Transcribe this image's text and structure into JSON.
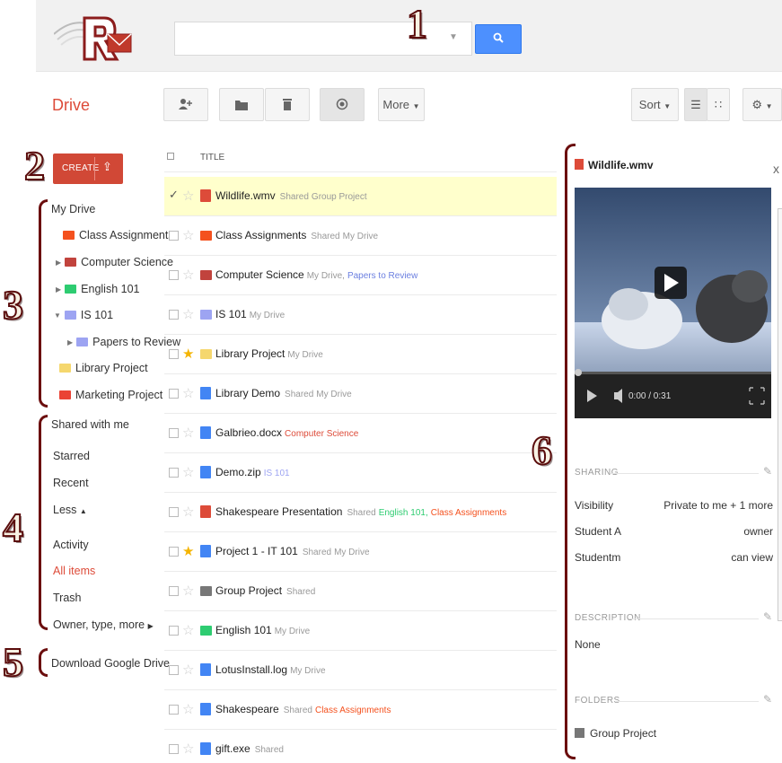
{
  "callouts": [
    "1",
    "2",
    "3",
    "4",
    "5",
    "6"
  ],
  "search": {
    "placeholder": "",
    "button_icon": "search-icon"
  },
  "toolbar": {
    "drive_label": "Drive",
    "more_label": "More",
    "sort_label": "Sort"
  },
  "nav": {
    "create_label": "CREATE",
    "my_drive": "My Drive",
    "folders": [
      {
        "label": "Class Assignments",
        "color": "#f4511e"
      },
      {
        "label": "Computer Science",
        "color": "#c1433d"
      },
      {
        "label": "English 101",
        "color": "#2ecc71"
      },
      {
        "label": "IS 101",
        "color": "#9da4f2"
      },
      {
        "label": "Papers to Review",
        "color": "#9da4f2"
      },
      {
        "label": "Library Project",
        "color": "#f5d76e"
      },
      {
        "label": "Marketing Project",
        "color": "#ea4335"
      }
    ],
    "shared_with_me": "Shared with me",
    "starred": "Starred",
    "recent": "Recent",
    "less": "Less",
    "activity": "Activity",
    "all_items": "All items",
    "trash": "Trash",
    "owner_type_more": "Owner, type, more",
    "download": "Download Google Drive"
  },
  "list": {
    "title_header": "TITLE",
    "rows": [
      {
        "name": "Wildlife.wmv",
        "tag": "Shared",
        "loc": "Group Project",
        "loc_color": "#999",
        "icon_color": "#dd4b39",
        "selected": true,
        "starred": false
      },
      {
        "name": "Class Assignments",
        "tag": "Shared",
        "loc": "My Drive",
        "loc_color": "#999",
        "icon_color": "#f4511e",
        "selected": false,
        "starred": false
      },
      {
        "name": "Computer Science",
        "tag": "",
        "loc": "My Drive,",
        "loc2": "Papers to Review",
        "loc_color": "#999",
        "loc2_color": "#6b7fe0",
        "icon_color": "#c1433d",
        "selected": false,
        "starred": false
      },
      {
        "name": "IS 101",
        "tag": "",
        "loc": "My Drive",
        "loc_color": "#999",
        "icon_color": "#9da4f2",
        "selected": false,
        "starred": false
      },
      {
        "name": "Library Project",
        "tag": "",
        "loc": "My Drive",
        "loc_color": "#999",
        "icon_color": "#f5d76e",
        "selected": false,
        "starred": true
      },
      {
        "name": "Library Demo",
        "tag": "Shared",
        "loc": "My Drive",
        "loc_color": "#999",
        "icon_color": "#4285f4",
        "selected": false,
        "starred": false
      },
      {
        "name": "Galbrieo.docx",
        "tag": "",
        "loc": "Computer Science",
        "loc_color": "#dd4b39",
        "icon_color": "#4285f4",
        "selected": false,
        "starred": false
      },
      {
        "name": "Demo.zip",
        "tag": "",
        "loc": "IS 101",
        "loc_color": "#9da4f2",
        "icon_color": "#4285f4",
        "selected": false,
        "starred": false
      },
      {
        "name": "Shakespeare Presentation",
        "tag": "Shared",
        "loc": "English 101,",
        "loc2": "Class Assignments",
        "loc_color": "#2ecc71",
        "loc2_color": "#f4511e",
        "icon_color": "#dd4b39",
        "selected": false,
        "starred": false
      },
      {
        "name": "Project 1 - IT 101",
        "tag": "Shared",
        "loc": "My Drive",
        "loc_color": "#999",
        "icon_color": "#4285f4",
        "selected": false,
        "starred": true
      },
      {
        "name": "Group Project",
        "tag": "Shared",
        "loc": "",
        "loc_color": "#999",
        "icon_color": "#777",
        "selected": false,
        "starred": false
      },
      {
        "name": "English 101",
        "tag": "",
        "loc": "My Drive",
        "loc_color": "#999",
        "icon_color": "#2ecc71",
        "selected": false,
        "starred": false
      },
      {
        "name": "LotusInstall.log",
        "tag": "",
        "loc": "My Drive",
        "loc_color": "#999",
        "icon_color": "#4285f4",
        "selected": false,
        "starred": false
      },
      {
        "name": "Shakespeare",
        "tag": "Shared",
        "loc": "Class Assignments",
        "loc_color": "#f4511e",
        "icon_color": "#4285f4",
        "selected": false,
        "starred": false
      },
      {
        "name": "gift.exe",
        "tag": "Shared",
        "loc": "",
        "loc_color": "#999",
        "icon_color": "#4285f4",
        "selected": false,
        "starred": false
      }
    ]
  },
  "details": {
    "file_name": "Wildlife.wmv",
    "close": "x",
    "video_time": "0:00 / 0:31",
    "sharing_label": "SHARING",
    "sharing": [
      {
        "who": "Visibility",
        "role": "Private to me + 1 more"
      },
      {
        "who": "Student A",
        "role": "owner"
      },
      {
        "who": "Studentm",
        "role": "can view"
      }
    ],
    "description_label": "DESCRIPTION",
    "description": "None",
    "folders_label": "FOLDERS",
    "folder": "Group Project"
  }
}
